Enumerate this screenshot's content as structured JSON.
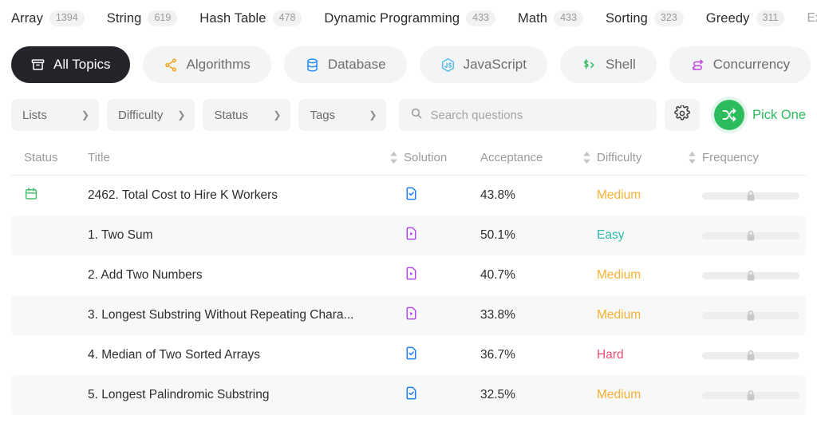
{
  "topics": {
    "tags": [
      {
        "name": "Array",
        "count": "1394"
      },
      {
        "name": "String",
        "count": "619"
      },
      {
        "name": "Hash Table",
        "count": "478"
      },
      {
        "name": "Dynamic Programming",
        "count": "433"
      },
      {
        "name": "Math",
        "count": "433"
      },
      {
        "name": "Sorting",
        "count": "323"
      },
      {
        "name": "Greedy",
        "count": "311"
      }
    ],
    "expand_label": "Expand",
    "expand_icon": "chevron-down-icon"
  },
  "categories": [
    {
      "label": "All Topics",
      "icon": "archive-box-icon",
      "active": true,
      "color": "#ffffff"
    },
    {
      "label": "Algorithms",
      "icon": "algorithm-nodes-icon",
      "active": false,
      "color": "#f5a623"
    },
    {
      "label": "Database",
      "icon": "database-cylinder-icon",
      "active": false,
      "color": "#2b8fff"
    },
    {
      "label": "JavaScript",
      "icon": "javascript-hexagon-icon",
      "active": false,
      "color": "#49b9e8"
    },
    {
      "label": "Shell",
      "icon": "shell-prompt-icon",
      "active": false,
      "color": "#3ec06a"
    },
    {
      "label": "Concurrency",
      "icon": "concurrency-arrows-icon",
      "active": false,
      "color": "#c252e0"
    }
  ],
  "filters": {
    "dropdowns": [
      {
        "label": "Lists"
      },
      {
        "label": "Difficulty"
      },
      {
        "label": "Status"
      },
      {
        "label": "Tags"
      }
    ],
    "search": {
      "placeholder": "Search questions",
      "value": "",
      "icon": "search-icon"
    },
    "settings_icon": "gear-icon",
    "pick_one": {
      "label": "Pick One",
      "icon": "shuffle-icon",
      "color": "#2cbb5d"
    }
  },
  "table": {
    "headers": {
      "status": "Status",
      "title": "Title",
      "solution": "Solution",
      "acceptance": "Acceptance",
      "difficulty": "Difficulty",
      "frequency": "Frequency"
    },
    "rows": [
      {
        "status_icon": "calendar-icon",
        "title": "2462. Total Cost to Hire K Workers",
        "solution_icon": "document-check-icon",
        "acceptance": "43.8%",
        "difficulty": "Medium",
        "frequency_icon": "lock-icon"
      },
      {
        "status_icon": "",
        "title": "1. Two Sum",
        "solution_icon": "document-play-icon",
        "acceptance": "50.1%",
        "difficulty": "Easy",
        "frequency_icon": "lock-icon"
      },
      {
        "status_icon": "",
        "title": "2. Add Two Numbers",
        "solution_icon": "document-play-icon",
        "acceptance": "40.7%",
        "difficulty": "Medium",
        "frequency_icon": "lock-icon"
      },
      {
        "status_icon": "",
        "title": "3. Longest Substring Without Repeating Chara...",
        "solution_icon": "document-play-icon",
        "acceptance": "33.8%",
        "difficulty": "Medium",
        "frequency_icon": "lock-icon"
      },
      {
        "status_icon": "",
        "title": "4. Median of Two Sorted Arrays",
        "solution_icon": "document-check-icon",
        "acceptance": "36.7%",
        "difficulty": "Hard",
        "frequency_icon": "lock-icon"
      },
      {
        "status_icon": "",
        "title": "5. Longest Palindromic Substring",
        "solution_icon": "document-check-icon",
        "acceptance": "32.5%",
        "difficulty": "Medium",
        "frequency_icon": "lock-icon"
      }
    ]
  },
  "colors": {
    "easy": "#2cbba8",
    "medium": "#f8b134",
    "hard": "#f24e6e",
    "accent_green": "#2cbb5d",
    "active_pill": "#23252a"
  }
}
